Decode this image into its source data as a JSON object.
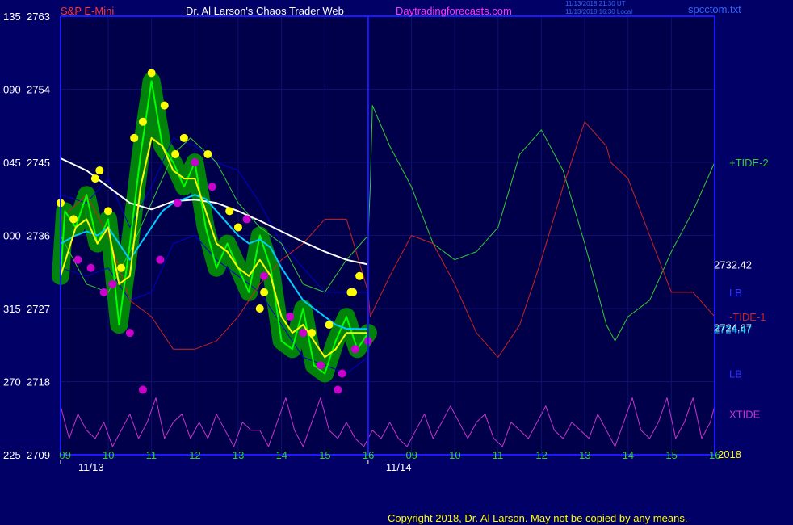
{
  "header": {
    "left": "S&P E-Mini",
    "center": "Dr. Al Larson's Chaos Trader Web",
    "site": "Daytradingforecasts.com",
    "stamp_line1": "11/13/2018 21:30 UT",
    "stamp_line2": "11/13/2018 16:30 Local",
    "file": "spcctom.txt"
  },
  "footer": {
    "copyright": "Copyright 2018, Dr. Al Larson. May not be copied by any means."
  },
  "colors": {
    "background": "#000066",
    "plot_bg": "#00004a",
    "grid": "#101070",
    "axis": "#1a1aff",
    "price": "#00ff00",
    "price_halo": "#009900",
    "yellow": "#ffff00",
    "magenta": "#cc00cc",
    "cyan": "#00ccff",
    "white": "#ffffff",
    "band": "#0000cc",
    "tide_up": "#33cc33",
    "tide_down": "#cc2222",
    "xtide": "#cc33cc"
  },
  "chart_data": {
    "type": "line",
    "ylim": [
      2709,
      2763
    ],
    "y_ticks": [
      {
        "left": "225",
        "value": 2709
      },
      {
        "left": "270",
        "value": 2718
      },
      {
        "left": "315",
        "value": 2727
      },
      {
        "left": "000",
        "value": 2736
      },
      {
        "left": "045",
        "value": 2745
      },
      {
        "left": "090",
        "value": 2754
      },
      {
        "left": "135",
        "value": 2763
      }
    ],
    "x_ticks_day1": [
      "09",
      "10",
      "11",
      "12",
      "13",
      "14",
      "15",
      "16"
    ],
    "x_ticks_day2": [
      "09",
      "10",
      "11",
      "12",
      "13",
      "14",
      "15",
      "16"
    ],
    "dates": [
      "11/13",
      "11/14"
    ],
    "year_label": "2018",
    "right_labels": [
      {
        "text": "+TIDE-2",
        "value": 2745,
        "color": "#33cc33"
      },
      {
        "text": "2732.42",
        "value": 2732.42,
        "color": "#ffffff"
      },
      {
        "text": "LB",
        "value": 2729,
        "color": "#3333ff"
      },
      {
        "text": "-TIDE-1",
        "value": 2726,
        "color": "#cc2222"
      },
      {
        "text": "2724.67",
        "value": 2724.67,
        "color": "#ffffff"
      },
      {
        "text": "2724.47",
        "value": 2724.47,
        "color": "#00ccff"
      },
      {
        "text": "LB",
        "value": 2719,
        "color": "#3333ff"
      },
      {
        "text": "XTIDE",
        "value": 2714,
        "color": "#cc33cc"
      }
    ],
    "series": [
      {
        "key": "price",
        "color": "#00ff00",
        "x": [
          8.9,
          9.0,
          9.25,
          9.5,
          9.75,
          10.0,
          10.25,
          10.5,
          10.75,
          11.0,
          11.25,
          11.5,
          11.75,
          12.0,
          12.25,
          12.5,
          12.75,
          13.0,
          13.25,
          13.5,
          13.75,
          14.0,
          14.25,
          14.5,
          14.75,
          15.0,
          15.25,
          15.5,
          15.75,
          16.0
        ],
        "y": [
          2731,
          2739,
          2737,
          2741,
          2735,
          2738,
          2725,
          2735,
          2746,
          2755,
          2747,
          2745,
          2742,
          2745,
          2737,
          2732,
          2735,
          2732,
          2729,
          2736,
          2732,
          2723,
          2722,
          2727,
          2720,
          2719,
          2723,
          2726,
          2722,
          2724
        ]
      },
      {
        "key": "short_avg",
        "color": "#ffff00",
        "x": [
          8.9,
          9.25,
          9.5,
          9.75,
          10.0,
          10.25,
          10.5,
          10.75,
          11.0,
          11.25,
          11.5,
          11.75,
          12.0,
          12.25,
          12.5,
          12.75,
          13.0,
          13.25,
          13.5,
          13.75,
          14.0,
          14.25,
          14.5,
          14.75,
          15.0,
          15.25,
          15.5,
          15.75,
          16.0
        ],
        "y": [
          2731,
          2737,
          2738,
          2735,
          2737,
          2730,
          2731,
          2742,
          2748,
          2747,
          2744,
          2743,
          2743,
          2739,
          2735,
          2734,
          2732,
          2731,
          2733,
          2731,
          2726,
          2724,
          2725,
          2723,
          2721,
          2722,
          2724,
          2724,
          2724
        ]
      },
      {
        "key": "med_avg",
        "color": "#00ccff",
        "x": [
          8.9,
          9.25,
          9.5,
          9.75,
          10.0,
          10.25,
          10.5,
          10.75,
          11.0,
          11.25,
          11.5,
          11.75,
          12.0,
          12.25,
          12.5,
          12.75,
          13.0,
          13.25,
          13.5,
          13.75,
          14.0,
          14.25,
          14.5,
          14.75,
          15.0,
          15.25,
          15.5,
          15.75,
          16.0
        ],
        "y": [
          2735,
          2736,
          2736.5,
          2736,
          2737,
          2735,
          2733,
          2735,
          2737,
          2739,
          2740,
          2740.5,
          2741,
          2740.5,
          2739,
          2737.5,
          2736,
          2735,
          2735.5,
          2734.5,
          2732,
          2730,
          2728,
          2727,
          2726,
          2725,
          2724.5,
          2724.5,
          2724.47
        ]
      },
      {
        "key": "long_avg",
        "color": "#ffffff",
        "x": [
          8.9,
          9.5,
          10.0,
          10.5,
          11.0,
          11.5,
          12.0,
          12.5,
          13.0,
          13.5,
          14.0,
          14.5,
          15.0,
          15.5,
          16.0
        ],
        "y": [
          2745.5,
          2744,
          2742,
          2740,
          2739.2,
          2740.2,
          2740.4,
          2740,
          2739,
          2737.8,
          2736.5,
          2735.2,
          2734,
          2733,
          2732.42
        ]
      },
      {
        "key": "upper_band",
        "color": "#0000cc",
        "x": [
          8.9,
          9.5,
          10.0,
          10.5,
          11.0,
          11.5,
          12.0,
          12.5,
          13.0,
          13.5,
          14.0,
          14.5,
          15.0,
          15.5,
          16.0
        ],
        "y": [
          2741,
          2740,
          2743,
          2737,
          2742,
          2748,
          2747,
          2745,
          2744,
          2740,
          2735,
          2732,
          2729,
          2729,
          2729
        ]
      },
      {
        "key": "lower_band",
        "color": "#0000cc",
        "x": [
          8.9,
          9.5,
          10.0,
          10.5,
          11.0,
          11.5,
          12.0,
          12.5,
          13.0,
          13.5,
          14.0,
          14.5,
          15.0,
          15.5,
          16.0
        ],
        "y": [
          2732,
          2731,
          2732,
          2728,
          2729,
          2735,
          2736,
          2733,
          2731,
          2729,
          2725,
          2721,
          2720,
          2719,
          2721
        ]
      },
      {
        "key": "tide_up",
        "color": "#33cc33",
        "x": [
          8.9,
          9.5,
          10.0,
          10.5,
          11.0,
          11.5,
          11.9,
          12.5,
          13.0,
          13.5,
          14.0,
          14.5,
          15.0,
          15.5,
          16.0,
          16.05,
          16.1,
          16.5,
          17.0,
          17.5,
          18.0,
          18.5,
          19.0,
          19.5,
          20.0,
          20.5,
          21.0,
          21.5,
          21.7,
          22.0,
          22.5,
          23.0,
          23.5,
          24.0
        ],
        "y": [
          2736,
          2730,
          2729,
          2734,
          2740,
          2746,
          2748,
          2745,
          2740,
          2737,
          2735,
          2730,
          2729,
          2733,
          2736,
          2742,
          2752,
          2747,
          2742,
          2735,
          2733,
          2734,
          2737,
          2746,
          2749,
          2744,
          2735,
          2725,
          2723,
          2726,
          2728,
          2734,
          2739,
          2745
        ]
      },
      {
        "key": "tide_down",
        "color": "#cc2222",
        "x": [
          8.9,
          9.5,
          10.0,
          10.5,
          11.0,
          11.5,
          12.0,
          12.5,
          13.0,
          13.5,
          14.0,
          14.5,
          15.0,
          15.5,
          16.0,
          16.05,
          16.5,
          17.0,
          17.5,
          18.0,
          18.5,
          19.0,
          19.5,
          20.0,
          20.5,
          21.0,
          21.5,
          21.6,
          22.0,
          22.5,
          23.0,
          23.5,
          24.0
        ],
        "y": [
          2738,
          2741,
          2736,
          2728,
          2726,
          2722,
          2722,
          2723,
          2726,
          2730,
          2733,
          2735,
          2738,
          2738,
          2729,
          2726,
          2731,
          2736,
          2735,
          2730,
          2724,
          2721,
          2725,
          2733,
          2742,
          2750,
          2747,
          2745,
          2743,
          2736,
          2729,
          2729,
          2726
        ]
      },
      {
        "key": "xtide",
        "color": "#cc33cc",
        "x": [
          8.9,
          9.1,
          9.3,
          9.5,
          9.7,
          9.9,
          10.1,
          10.3,
          10.5,
          10.7,
          10.9,
          11.1,
          11.3,
          11.5,
          11.7,
          11.9,
          12.1,
          12.3,
          12.5,
          12.7,
          12.9,
          13.1,
          13.3,
          13.5,
          13.7,
          13.9,
          14.1,
          14.3,
          14.5,
          14.7,
          14.9,
          15.1,
          15.3,
          15.5,
          15.7,
          15.9,
          16.1,
          16.3,
          16.5,
          16.7,
          16.9,
          17.1,
          17.3,
          17.5,
          17.7,
          17.9,
          18.1,
          18.3,
          18.5,
          18.7,
          18.9,
          19.1,
          19.3,
          19.5,
          19.7,
          19.9,
          20.1,
          20.3,
          20.5,
          20.7,
          20.9,
          21.1,
          21.3,
          21.5,
          21.7,
          21.9,
          22.1,
          22.3,
          22.5,
          22.7,
          22.9,
          23.1,
          23.3,
          23.5,
          23.7,
          23.9,
          24.0
        ],
        "y": [
          2715,
          2711,
          2714,
          2712,
          2711,
          2713,
          2710,
          2712,
          2714,
          2711,
          2713,
          2716,
          2711,
          2713,
          2714,
          2711,
          2713,
          2711,
          2714,
          2712,
          2710,
          2713,
          2712,
          2712,
          2710,
          2713,
          2716,
          2712,
          2710,
          2713,
          2716,
          2712,
          2711,
          2713,
          2711,
          2710,
          2712,
          2711,
          2713,
          2711,
          2710,
          2712,
          2714,
          2711,
          2713,
          2715,
          2713,
          2711,
          2713,
          2714,
          2711,
          2710,
          2713,
          2712,
          2711,
          2713,
          2715,
          2712,
          2711,
          2713,
          2712,
          2711,
          2714,
          2712,
          2710,
          2713,
          2716,
          2712,
          2711,
          2713,
          2716,
          2711,
          2713,
          2716,
          2711,
          2713,
          2715
        ]
      }
    ],
    "top_markers": {
      "x": [
        8.9,
        9.2,
        9.7,
        9.8,
        10.0,
        10.3,
        10.6,
        10.8,
        11.0,
        11.3,
        11.55,
        11.75,
        12.3,
        12.8,
        13.0,
        13.6,
        13.5,
        14.7,
        15.1,
        15.6,
        15.65,
        15.8
      ],
      "y": [
        2740,
        2738,
        2743,
        2744,
        2739,
        2732,
        2748,
        2750,
        2756,
        2752,
        2746,
        2748,
        2746,
        2739,
        2737,
        2729,
        2727,
        2724,
        2725,
        2729,
        2729,
        2731
      ]
    },
    "bottom_markers": {
      "x": [
        9.3,
        9.6,
        9.9,
        10.1,
        10.5,
        10.8,
        11.2,
        11.6,
        12.0,
        12.4,
        13.2,
        13.6,
        14.2,
        14.5,
        14.9,
        15.3,
        15.4,
        15.7,
        16.0
      ],
      "y": [
        2733,
        2732,
        2729,
        2730,
        2724,
        2717,
        2733,
        2740,
        2745,
        2742,
        2738,
        2731,
        2726,
        2724,
        2720,
        2717,
        2719,
        2722,
        2723
      ]
    }
  }
}
